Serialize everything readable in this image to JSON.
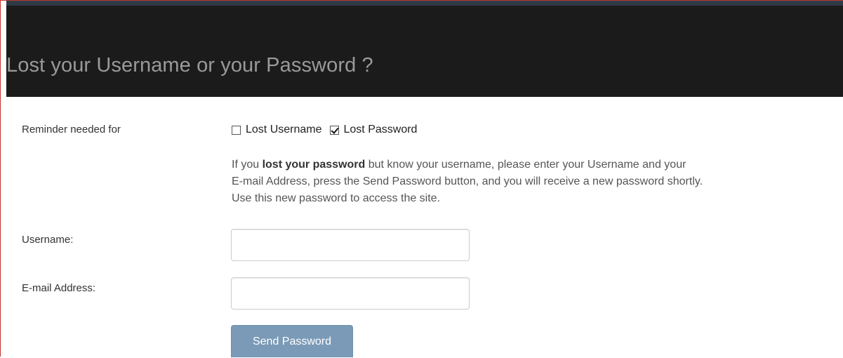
{
  "header": {
    "title": "Lost your Username or your Password ?"
  },
  "form": {
    "reminder_label": "Reminder needed for",
    "options": [
      {
        "label": "Lost Username",
        "checked": false
      },
      {
        "label": "Lost Password",
        "checked": true
      }
    ],
    "help": {
      "prefix": "If you ",
      "bold": "lost your password",
      "line1_rest": " but know your username, please enter your Username and your",
      "line2": "E-mail Address, press the Send Password button, and you will receive a new password shortly.",
      "line3": "Use this new password to access the site."
    },
    "username_label": "Username:",
    "username_value": "",
    "email_label": "E-mail Address:",
    "email_value": "",
    "submit_label": "Send Password"
  },
  "colors": {
    "header_bg": "#1b1b1b",
    "header_text": "#9a9a9a",
    "button_bg": "#7a9ab7",
    "frame_border": "#c0392b"
  }
}
